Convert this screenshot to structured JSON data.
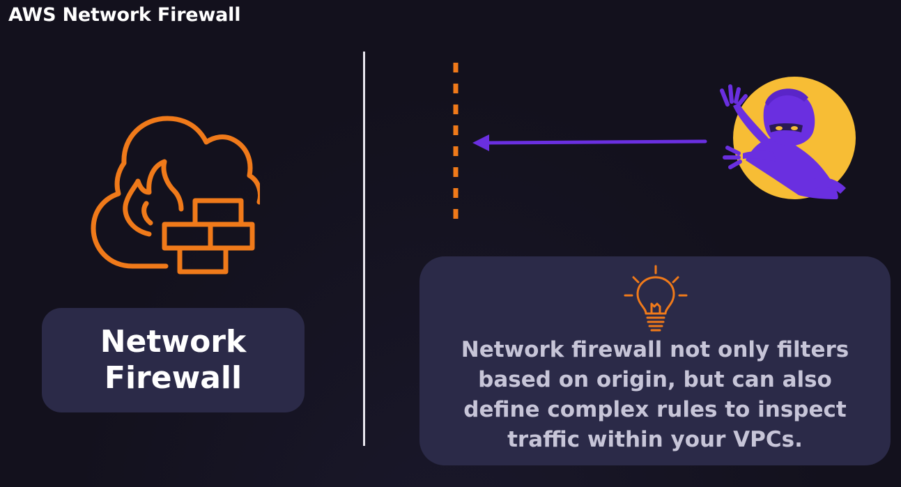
{
  "header": {
    "title": "AWS Network Firewall"
  },
  "left_panel": {
    "icon": "cloud-fire-brick-wall-icon",
    "label_line1": "Network",
    "label_line2": "Firewall"
  },
  "right_panel": {
    "barrier": "dashed-firewall-line",
    "attacker": "hacker-illustration",
    "arrow": "arrow-left-icon",
    "tip_icon": "lightbulb-icon",
    "info_text": "Network firewall not only filters based on origin, but can also define complex rules to inspect traffic within your VPCs."
  },
  "colors": {
    "background": "#13111d",
    "panel": "#2b2a48",
    "accent_orange": "#f07a1a",
    "accent_purple": "#6a2fe0",
    "accent_yellow": "#f7bd35",
    "text_white": "#ffffff",
    "text_muted": "#c7c5d8"
  }
}
